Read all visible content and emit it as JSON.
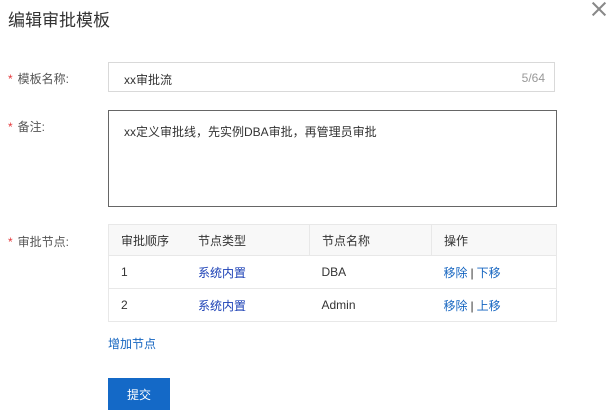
{
  "dialog": {
    "title": "编辑审批模板",
    "close_icon": "close-icon"
  },
  "form": {
    "template_name": {
      "required_mark": "*",
      "label": "模板名称:",
      "value": "xx审批流",
      "counter": "5/64"
    },
    "remark": {
      "required_mark": "*",
      "label": "备注:",
      "value": "xx定义审批线，先实例DBA审批，再管理员审批"
    },
    "nodes": {
      "required_mark": "*",
      "label": "审批节点:",
      "columns": [
        "审批顺序",
        "节点类型",
        "节点名称",
        "操作"
      ],
      "rows": [
        {
          "order": "1",
          "type": "系统内置",
          "name": "DBA",
          "action_remove": "移除",
          "action_sep": "|",
          "action_move": "下移"
        },
        {
          "order": "2",
          "type": "系统内置",
          "name": "Admin",
          "action_remove": "移除",
          "action_sep": "|",
          "action_move": "上移"
        }
      ],
      "add_label": "增加节点"
    },
    "submit_label": "提交"
  }
}
